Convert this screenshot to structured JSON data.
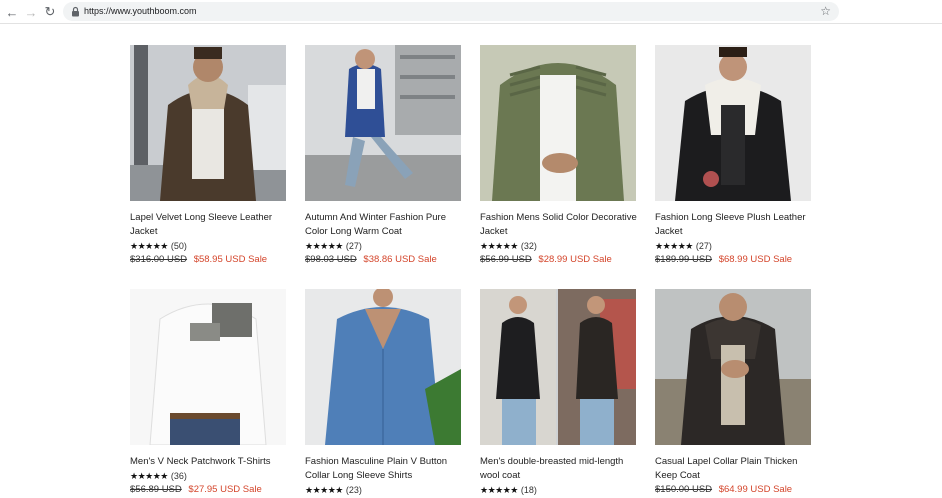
{
  "browser": {
    "url": "https://www.youthboom.com",
    "back_icon": "arrow-left-icon",
    "forward_icon": "arrow-right-icon",
    "reload_icon": "reload-icon",
    "lock_icon": "lock-icon",
    "bookmark_icon": "star-outline-icon"
  },
  "colors": {
    "sale_price": "#d4452b",
    "star_fill": "#111111",
    "text": "#222222"
  },
  "products": [
    {
      "title": "Lapel Velvet Long Sleeve Leather Jacket",
      "stars": "★★★★★",
      "reviews": "(50)",
      "old_price": "$316.00 USD",
      "sale_price": "$58.95 USD Sale"
    },
    {
      "title": "Autumn And Winter Fashion Pure Color Long Warm Coat",
      "stars": "★★★★★",
      "reviews": "(27)",
      "old_price": "$98.03 USD",
      "sale_price": "$38.86 USD Sale"
    },
    {
      "title": "Fashion Mens Solid Color Decorative Jacket",
      "stars": "★★★★★",
      "reviews": "(32)",
      "old_price": "$56.99 USD",
      "sale_price": "$28.99 USD Sale"
    },
    {
      "title": "Fashion Long Sleeve Plush Leather Jacket",
      "stars": "★★★★★",
      "reviews": "(27)",
      "old_price": "$189.99 USD",
      "sale_price": "$68.99 USD Sale"
    },
    {
      "title": "Men's V Neck Patchwork T-Shirts",
      "stars": "★★★★★",
      "reviews": "(36)",
      "old_price": "$56.89 USD",
      "sale_price": "$27.95 USD Sale"
    },
    {
      "title": "Fashion Masculine Plain V Button Collar Long Sleeve Shirts",
      "stars": "★★★★★",
      "reviews": "(23)",
      "old_price": "",
      "sale_price": ""
    },
    {
      "title": "Men's double-breasted mid-length wool coat",
      "stars": "★★★★★",
      "reviews": "(18)",
      "old_price": "",
      "sale_price": ""
    },
    {
      "title": "Casual Lapel Collar Plain Thicken Keep Coat",
      "stars": "",
      "reviews": "",
      "old_price": "$150.00 USD",
      "sale_price": "$64.99 USD Sale"
    }
  ]
}
